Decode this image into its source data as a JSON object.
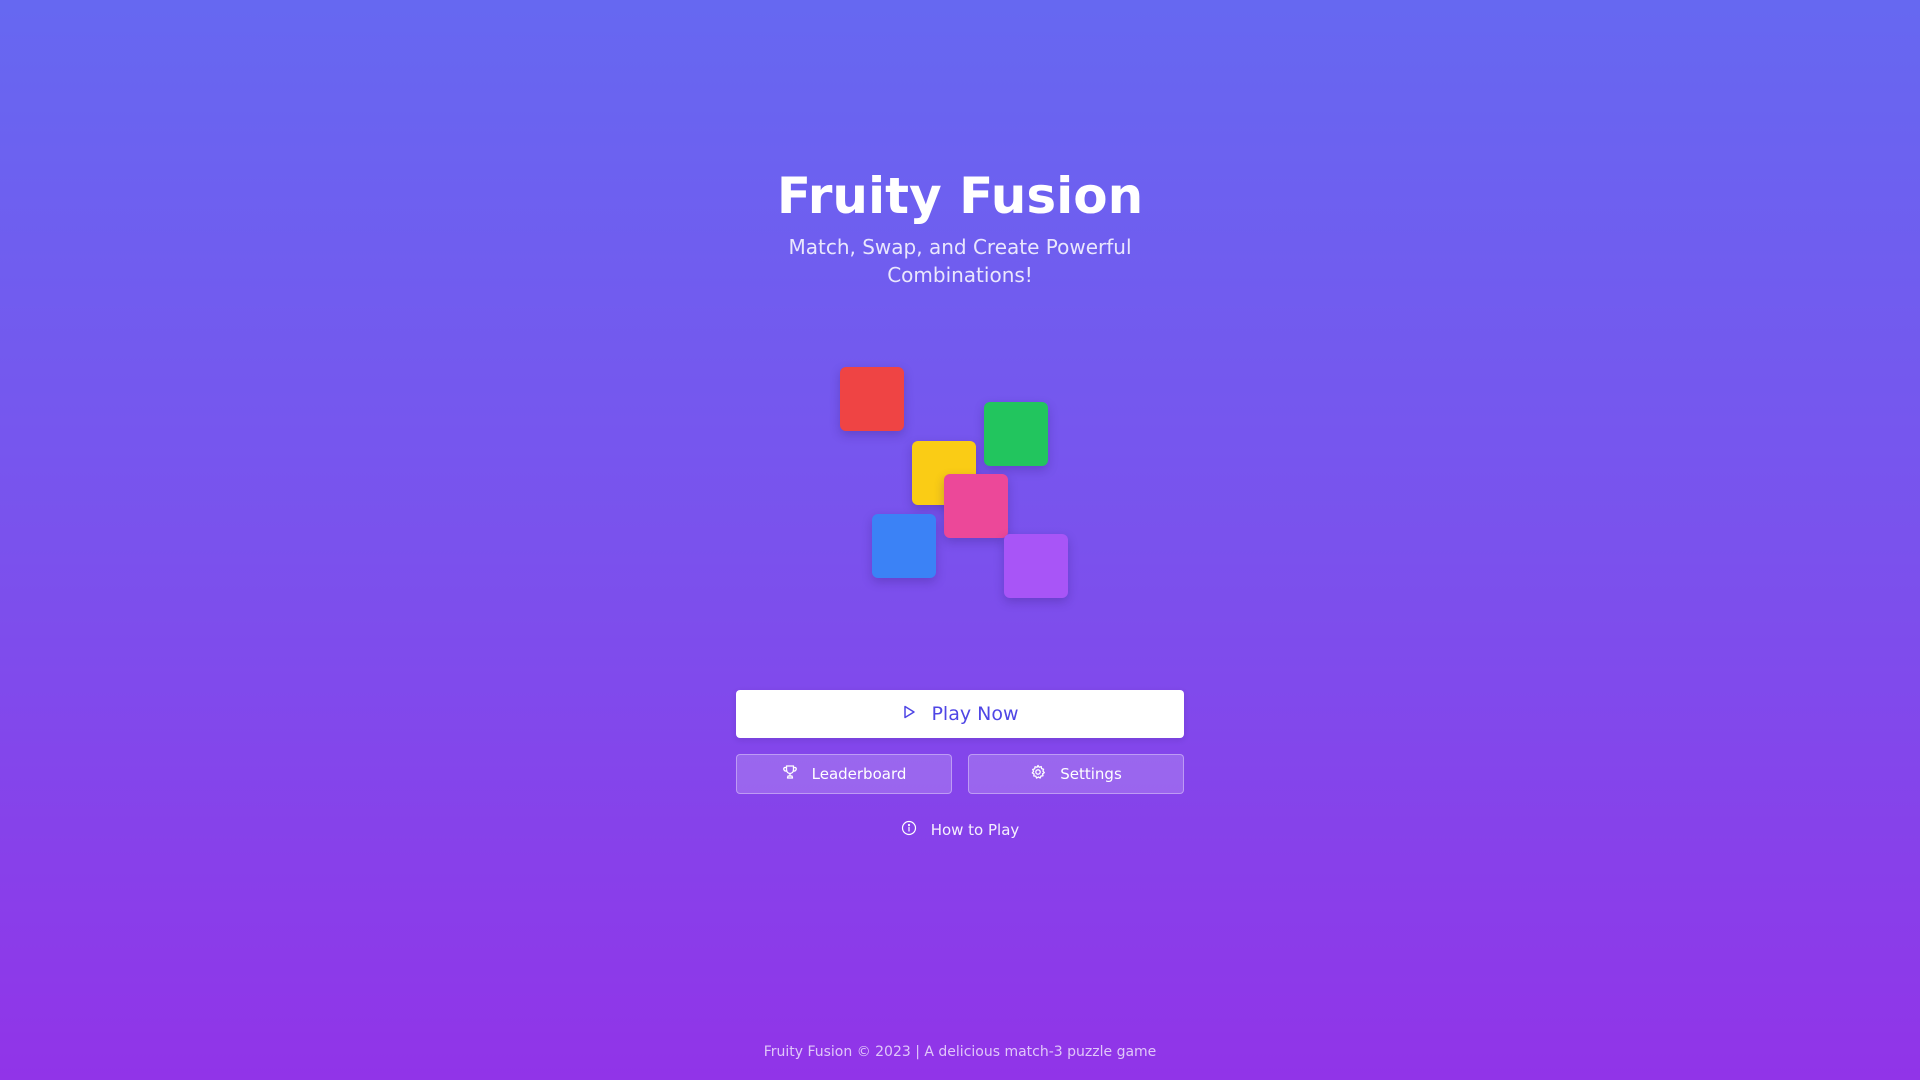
{
  "game": {
    "title": "Fruity Fusion",
    "subtitle": "Match, Swap, and Create Powerful Combinations!"
  },
  "tiles": [
    {
      "name": "red",
      "color": "#ef4444"
    },
    {
      "name": "green",
      "color": "#22c55e"
    },
    {
      "name": "yellow",
      "color": "#facc15"
    },
    {
      "name": "pink",
      "color": "#ec4899"
    },
    {
      "name": "blue",
      "color": "#3b82f6"
    },
    {
      "name": "purple",
      "color": "#a855f7"
    }
  ],
  "menu": {
    "play_label": "Play Now",
    "play_icon": "play-icon",
    "leaderboard_label": "Leaderboard",
    "leaderboard_icon": "trophy-icon",
    "settings_label": "Settings",
    "settings_icon": "gear-icon",
    "how_to_label": "How to Play",
    "how_to_icon": "info-icon"
  },
  "footer": {
    "text": "Fruity Fusion © 2023 | A delicious match-3 puzzle game"
  },
  "colors": {
    "accent": "#4f46e5",
    "background_top": "#6668f1",
    "background_bottom": "#9134e8"
  }
}
